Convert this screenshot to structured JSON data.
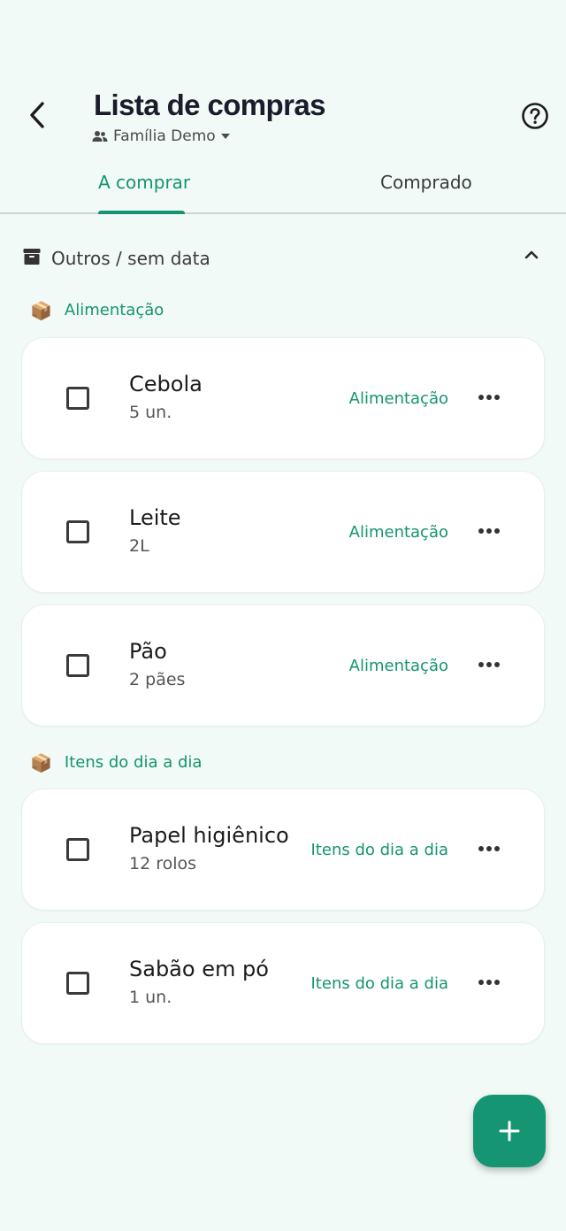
{
  "header": {
    "title": "Lista de compras",
    "family": "Família Demo"
  },
  "tabs": [
    {
      "label": "A comprar",
      "active": true
    },
    {
      "label": "Comprado",
      "active": false
    }
  ],
  "section": {
    "title": "Outros / sem data"
  },
  "categories": [
    {
      "label": "Alimentação"
    },
    {
      "label": "Itens do dia a dia"
    }
  ],
  "items": [
    {
      "name": "Cebola",
      "qty": "5 un.",
      "tag": "Alimentação"
    },
    {
      "name": "Leite",
      "qty": "2L",
      "tag": "Alimentação"
    },
    {
      "name": "Pão",
      "qty": "2 pães",
      "tag": "Alimentação"
    },
    {
      "name": "Papel higiênico",
      "qty": "12 rolos",
      "tag": "Itens do dia a dia"
    },
    {
      "name": "Sabão em pó",
      "qty": "1 un.",
      "tag": "Itens do dia a dia"
    }
  ],
  "colors": {
    "accent": "#149470",
    "background": "#f2faf7",
    "card": "#ffffff"
  },
  "icons": {
    "back": "arrow-left-icon",
    "help": "help-circle-icon",
    "people": "people-icon",
    "dropdown": "caret-down-icon",
    "archive": "archive-icon",
    "collapse": "chevron-up-icon",
    "category": "package-icon",
    "more": "more-horizontal-icon",
    "add": "plus-icon"
  }
}
